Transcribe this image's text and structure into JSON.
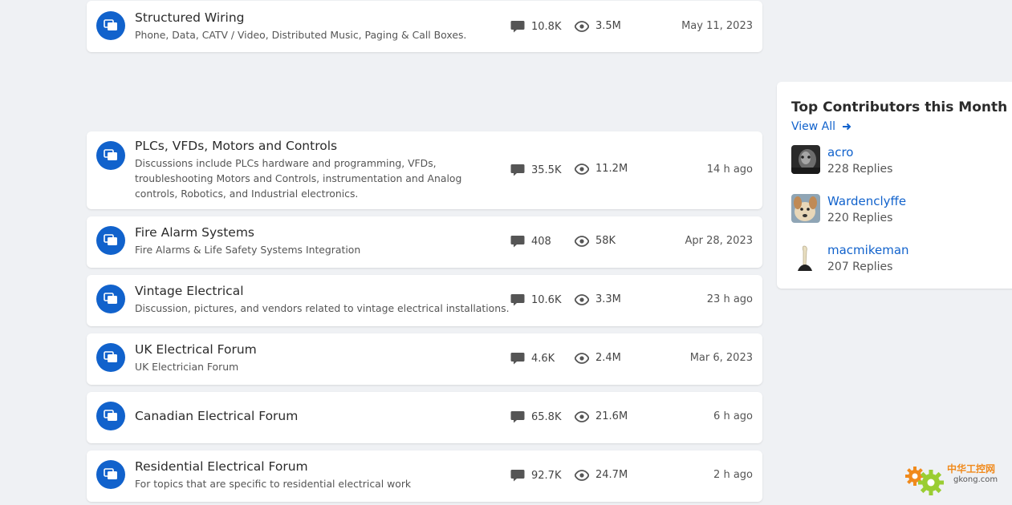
{
  "forums": [
    {
      "title": "Structured Wiring",
      "description": [
        "Phone, Data, CATV / Video, Distributed Music, Paging & Call Boxes."
      ],
      "replies": "10.8K",
      "views": "3.5M",
      "last_activity": "May 11, 2023"
    },
    {
      "title": "PLCs, VFDs, Motors and Controls",
      "description": [
        "Discussions include PLCs hardware and programming, VFDs,",
        "troubleshooting Motors and Controls, instrumentation and Analog",
        "controls, Robotics, and Industrial electronics."
      ],
      "replies": "35.5K",
      "views": "11.2M",
      "last_activity": "14 h ago"
    },
    {
      "title": "Fire Alarm Systems",
      "description": [
        "Fire Alarms & Life Safety Systems Integration"
      ],
      "replies": "408",
      "views": "58K",
      "last_activity": "Apr 28, 2023"
    },
    {
      "title": "Vintage Electrical",
      "description": [
        "Discussion, pictures, and vendors related to vintage electrical installations."
      ],
      "replies": "10.6K",
      "views": "3.3M",
      "last_activity": "23 h ago"
    },
    {
      "title": "UK Electrical Forum",
      "description": [
        "UK Electrician Forum"
      ],
      "replies": "4.6K",
      "views": "2.4M",
      "last_activity": "Mar 6, 2023"
    },
    {
      "title": "Canadian Electrical Forum",
      "description": [],
      "replies": "65.8K",
      "views": "21.6M",
      "last_activity": "6 h ago"
    },
    {
      "title": "Residential Electrical Forum",
      "description": [
        "For topics that are specific to residential electrical work"
      ],
      "replies": "92.7K",
      "views": "24.7M",
      "last_activity": "2 h ago"
    }
  ],
  "sidebar": {
    "title": "Top Contributors this Month",
    "view_all": "View All",
    "contributors": [
      {
        "name": "acro",
        "replies": "228 Replies"
      },
      {
        "name": "Wardenclyffe",
        "replies": "220 Replies"
      },
      {
        "name": "macmikeman",
        "replies": "207 Replies"
      }
    ]
  },
  "watermark": {
    "text": "中华工控网",
    "domain": "gkong.com"
  },
  "colors": {
    "accent": "#1162cc",
    "page_bg": "#eff1f4",
    "card_bg": "#ffffff"
  },
  "icons": {
    "forum": "chat-bubbles-icon",
    "replies": "comment-icon",
    "views": "eye-icon",
    "view_all": "arrow-right-icon"
  }
}
